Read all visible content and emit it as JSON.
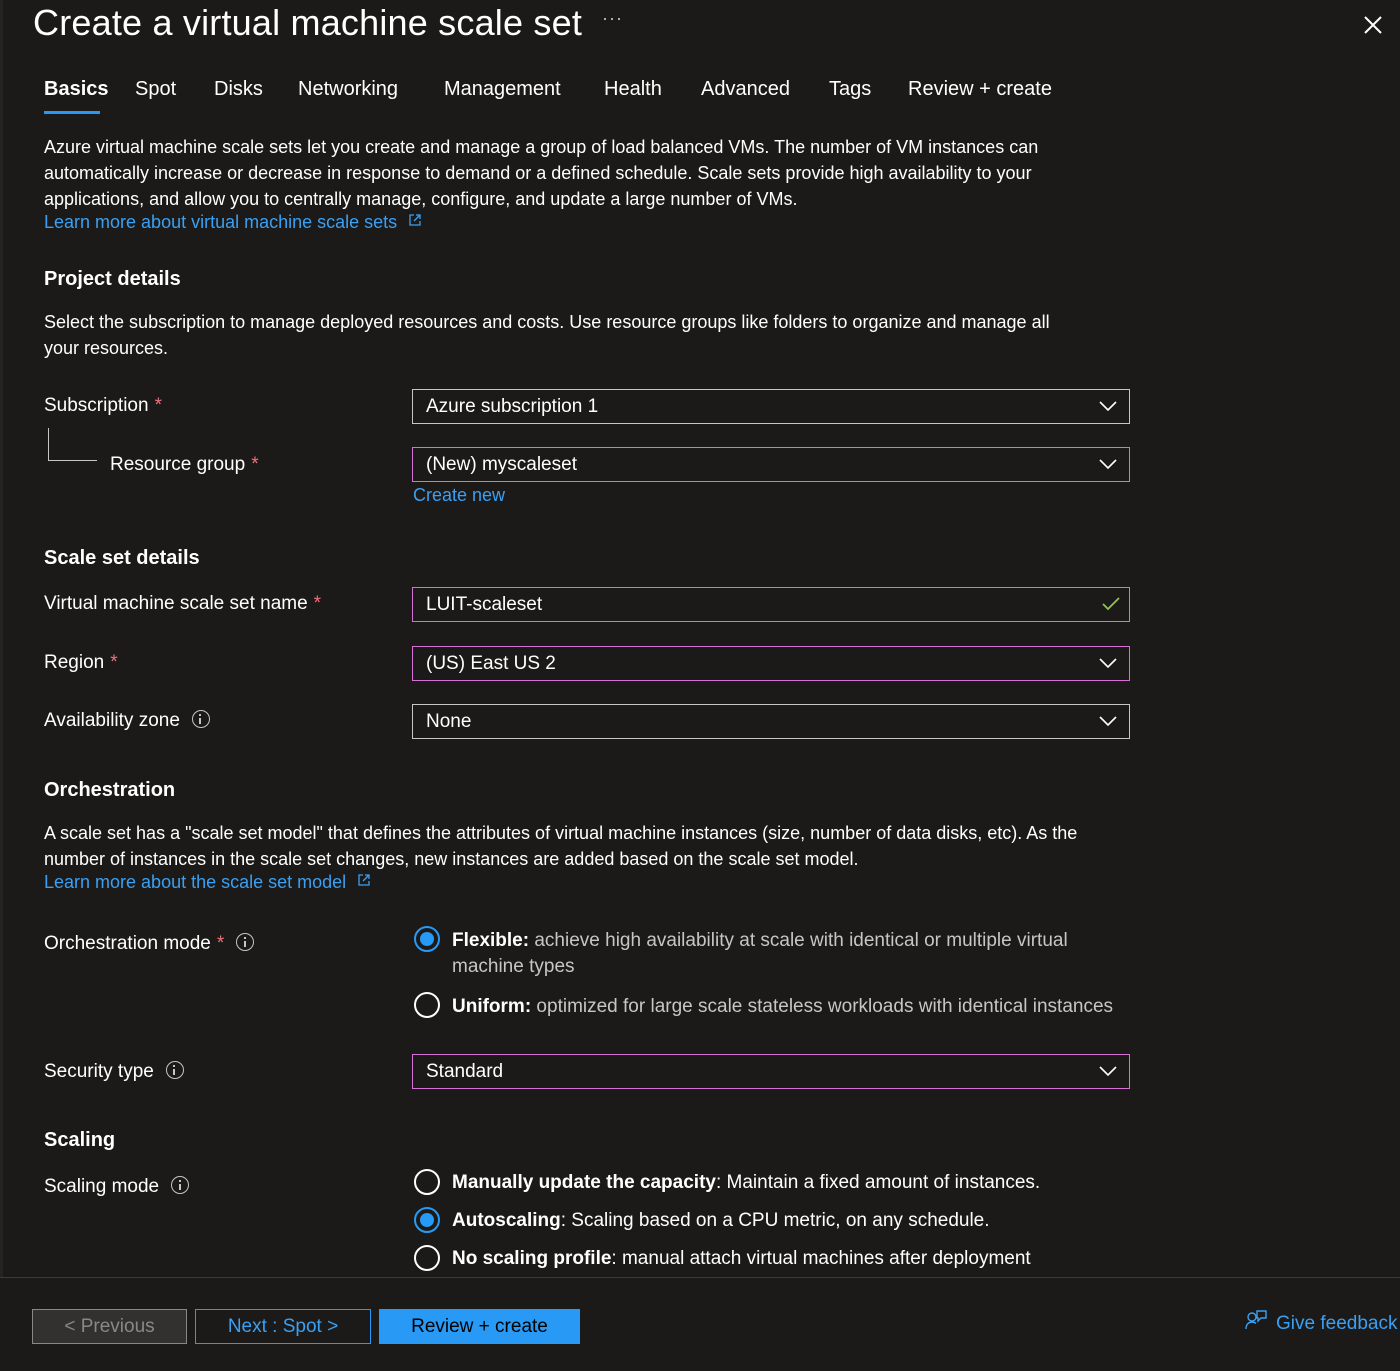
{
  "header": {
    "title": "Create a virtual machine scale set",
    "more_label": "···"
  },
  "tabs": [
    {
      "label": "Basics"
    },
    {
      "label": "Spot"
    },
    {
      "label": "Disks"
    },
    {
      "label": "Networking"
    },
    {
      "label": "Management"
    },
    {
      "label": "Health"
    },
    {
      "label": "Advanced"
    },
    {
      "label": "Tags"
    },
    {
      "label": "Review + create"
    }
  ],
  "intro": {
    "lines": [
      "Azure virtual machine scale sets let you create and manage a group of load balanced VMs. The number of VM instances can",
      "automatically increase or decrease in response to demand or a defined schedule. Scale sets provide high availability to your",
      "applications, and allow you to centrally manage, configure, and update a large number of VMs."
    ],
    "link": "Learn more about virtual machine scale sets"
  },
  "project": {
    "heading": "Project details",
    "lines": [
      "Select the subscription to manage deployed resources and costs. Use resource groups like folders to organize and manage all",
      "your resources."
    ],
    "subscription_label": "Subscription",
    "subscription_value": "Azure subscription 1",
    "resource_group_label": "Resource group",
    "resource_group_value": "(New) myscaleset",
    "create_new": "Create new"
  },
  "scaleset": {
    "heading": "Scale set details",
    "name_label": "Virtual machine scale set name",
    "name_value": "LUIT-scaleset",
    "region_label": "Region",
    "region_value": "(US) East US 2",
    "zone_label": "Availability zone",
    "zone_value": "None"
  },
  "orchestration": {
    "heading": "Orchestration",
    "lines": [
      "A scale set has a \"scale set model\" that defines the attributes of virtual machine instances (size, number of data disks, etc). As the",
      "number of instances in the scale set changes, new instances are added based on the scale set model."
    ],
    "link": "Learn more about the scale set model",
    "mode_label": "Orchestration mode",
    "flexible_title": "Flexible:",
    "flexible_desc_1": " achieve high availability at scale with identical or multiple virtual",
    "flexible_desc_2": "machine types",
    "uniform_title": "Uniform:",
    "uniform_desc": " optimized for large scale stateless workloads with identical instances",
    "selected": "Flexible",
    "security_label": "Security type",
    "security_value": "Standard"
  },
  "scaling": {
    "heading": "Scaling",
    "mode_label": "Scaling mode",
    "manual_title": "Manually update the capacity",
    "manual_desc": ": Maintain a fixed amount of instances.",
    "auto_title": "Autoscaling",
    "auto_desc": ": Scaling based on a CPU metric, on any schedule.",
    "none_title": "No scaling profile",
    "none_desc": ": manual attach virtual machines after deployment",
    "selected": "Autoscaling"
  },
  "footer": {
    "previous": "< Previous",
    "next": "Next : Spot >",
    "review": "Review + create",
    "feedback": "Give feedback"
  },
  "colors": {
    "background": "#1b1a19",
    "accent": "#2899f5",
    "link": "#3aa0f3",
    "required": "#f1707b",
    "focus_border": "#d670d6",
    "valid_check": "#92c353"
  },
  "required_marker": "*"
}
